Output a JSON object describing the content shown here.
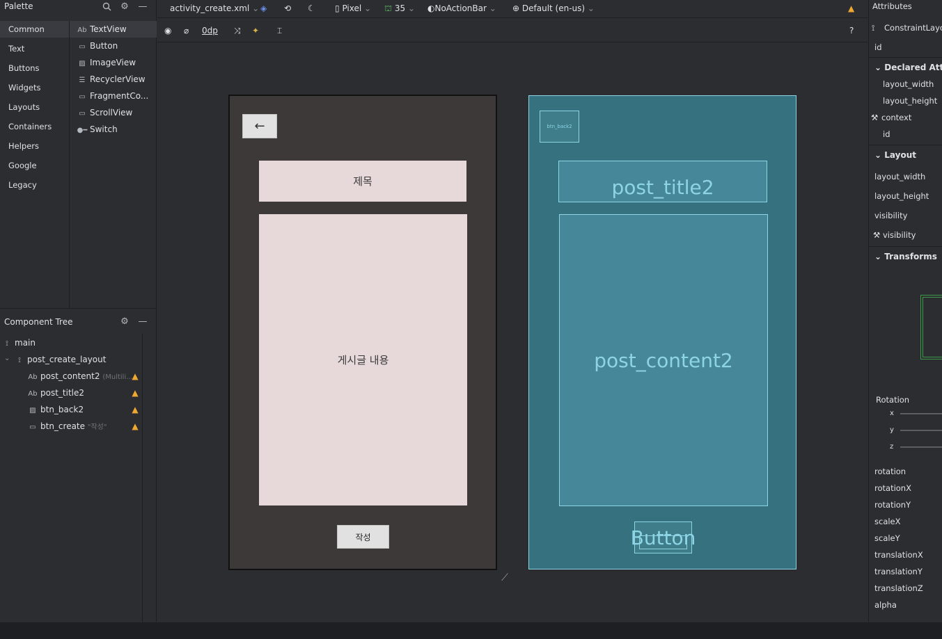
{
  "palette": {
    "title": "Palette",
    "categories": [
      "Common",
      "Text",
      "Buttons",
      "Widgets",
      "Layouts",
      "Containers",
      "Helpers",
      "Google",
      "Legacy"
    ],
    "widgets": [
      {
        "icon": "Ab",
        "label": "TextView"
      },
      {
        "icon": "▭",
        "label": "Button"
      },
      {
        "icon": "▨",
        "label": "ImageView"
      },
      {
        "icon": "☰",
        "label": "RecyclerView"
      },
      {
        "icon": "▭",
        "label": "FragmentCo..."
      },
      {
        "icon": "▭",
        "label": "ScrollView"
      },
      {
        "icon": "●━",
        "label": "Switch"
      }
    ]
  },
  "tree": {
    "title": "Component Tree",
    "nodes": [
      {
        "icon": "⟟",
        "label": "main",
        "hint": ""
      },
      {
        "icon": "⟟",
        "label": "post_create_layout",
        "hint": ""
      },
      {
        "icon": "Ab",
        "label": "post_content2",
        "hint": "(Multili..."
      },
      {
        "icon": "Ab",
        "label": "post_title2",
        "hint": ""
      },
      {
        "icon": "▨",
        "label": "btn_back2",
        "hint": ""
      },
      {
        "icon": "▭",
        "label": "btn_create",
        "hint": "\"작성\""
      }
    ]
  },
  "toolbar": {
    "file": "activity_create.xml",
    "device": "Pixel",
    "api": "35",
    "theme": "NoActionBar",
    "locale": "Default (en-us)",
    "margin": "0dp",
    "help": "?"
  },
  "design": {
    "title_text": "제목",
    "content_text": "게시글 내용",
    "create_text": "작성",
    "back_arrow": "←"
  },
  "blueprint": {
    "back_label": "btn_back2",
    "title_label": "post_title2",
    "content_label": "post_content2",
    "button_label": "Button"
  },
  "attributes": {
    "title": "Attributes",
    "root": "ConstraintLayout",
    "id_label": "id",
    "declared_title": "Declared Attributes",
    "declared": [
      "layout_width",
      "layout_height",
      "context",
      "id"
    ],
    "layout_title": "Layout",
    "layout": [
      "layout_width",
      "layout_height",
      "visibility",
      "visibility"
    ],
    "transforms_title": "Transforms",
    "rotation_title": "Rotation",
    "axes": [
      "x",
      "y",
      "z"
    ],
    "transform_props": [
      "rotation",
      "rotationX",
      "rotationY",
      "scaleX",
      "scaleY",
      "translationX",
      "translationY",
      "translationZ",
      "alpha"
    ]
  }
}
